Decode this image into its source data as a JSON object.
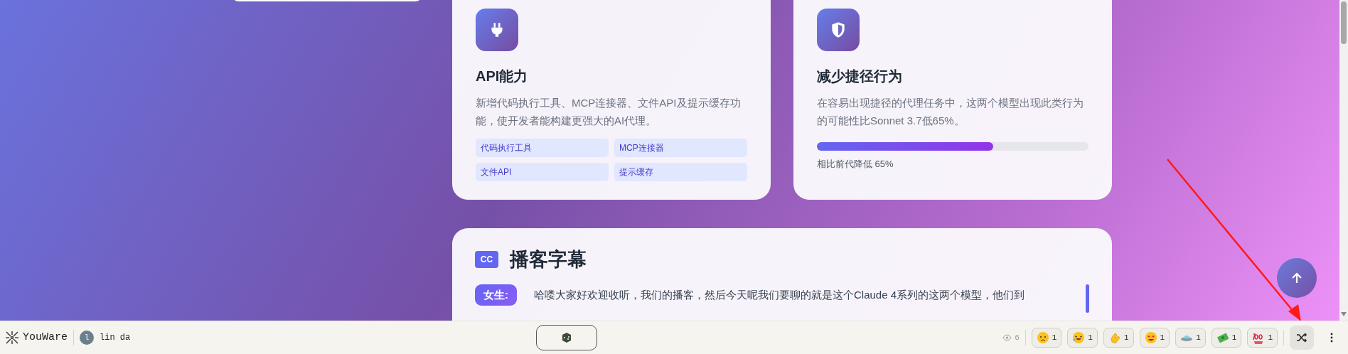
{
  "feature_cards": [
    {
      "title": "API能力",
      "description": "新增代码执行工具、MCP连接器、文件API及提示缓存功能，使开发者能构建更强大的AI代理。",
      "tags": [
        "代码执行工具",
        "MCP连接器",
        "文件API",
        "提示缓存"
      ]
    },
    {
      "title": "减少捷径行为",
      "description": "在容易出现捷径的代理任务中，这两个模型出现此类行为的可能性比Sonnet 3.7低65%。",
      "progress": {
        "level": 0.65,
        "caption": "相比前代降低 65%"
      }
    }
  ],
  "transcript": {
    "badge": "CC",
    "title": "播客字幕",
    "lines": [
      {
        "speaker": "女生:",
        "text": "哈喽大家好欢迎收听，我们的播客，然后今天呢我们要聊的就是这个Claude 4系列的这两个模型，他们到"
      }
    ]
  },
  "bottom_bar": {
    "brand": "YouWare",
    "avatar_letter": "l",
    "user": "lin da",
    "views": "6",
    "reactions": [
      {
        "kind": "worried",
        "count": "1"
      },
      {
        "kind": "rofl",
        "count": "1"
      },
      {
        "kind": "clap",
        "count": "1"
      },
      {
        "kind": "hearteyes",
        "count": "1"
      },
      {
        "kind": "ufo",
        "count": "1"
      },
      {
        "kind": "money",
        "count": "1"
      },
      {
        "kind": "hundred",
        "count": "1"
      }
    ]
  }
}
